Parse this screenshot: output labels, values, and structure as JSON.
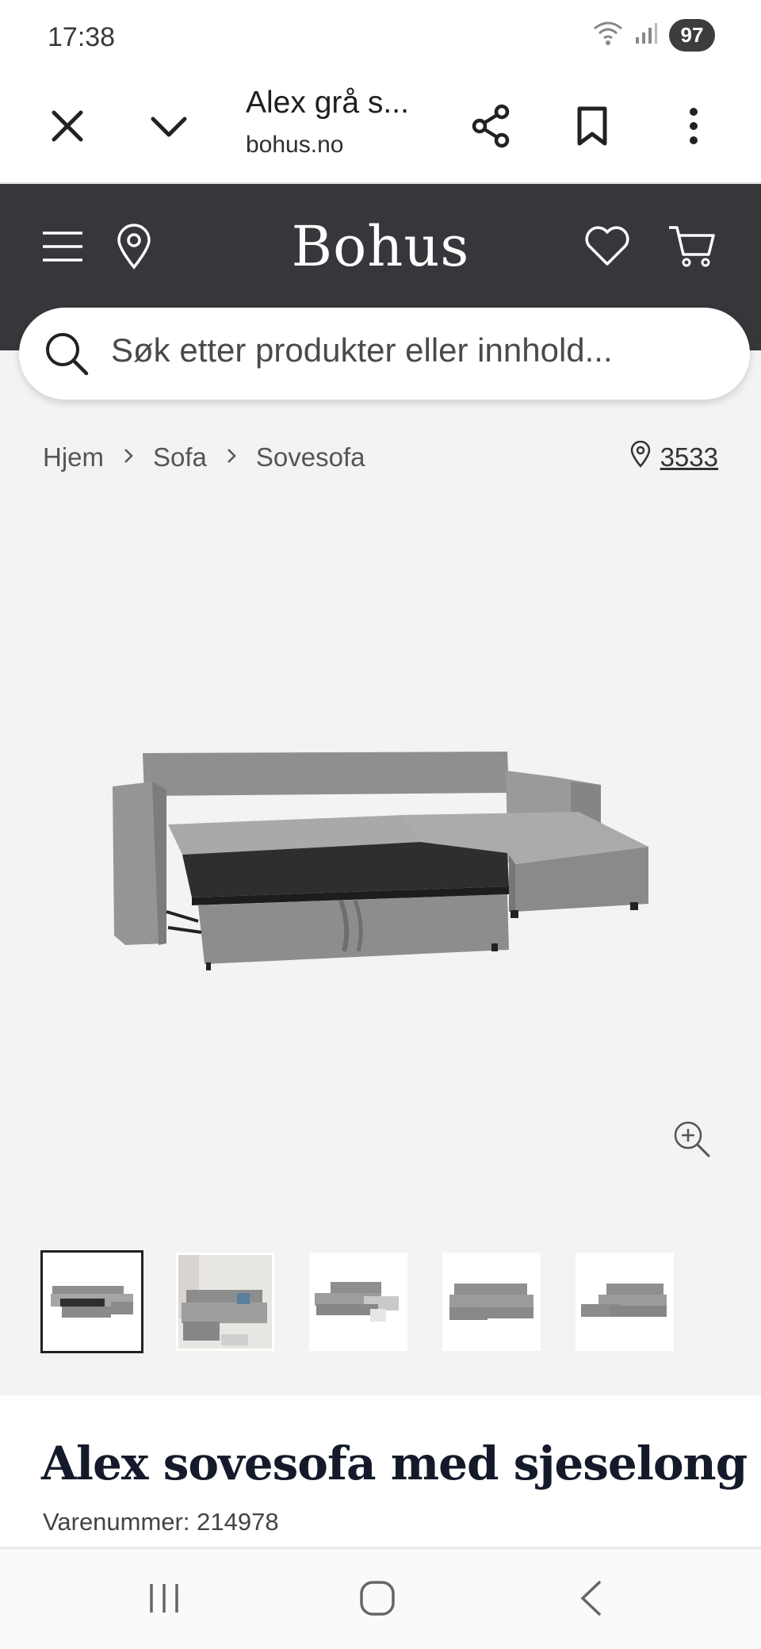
{
  "status_bar": {
    "time": "17:38",
    "battery": "97"
  },
  "browser": {
    "title": "Alex grå s...",
    "url": "bohus.no"
  },
  "site": {
    "logo": "Bohus"
  },
  "search": {
    "placeholder": "Søk etter produkter eller innhold..."
  },
  "breadcrumb": {
    "items": [
      "Hjem",
      "Sofa",
      "Sovesofa"
    ]
  },
  "store": {
    "number": "3533"
  },
  "gallery": {
    "thumbnail_count": 5,
    "selected_index": 0
  },
  "product": {
    "title": "Alex sovesofa med sjeselong",
    "sku_label": "Varenummer:",
    "sku": "214978"
  },
  "colors": {
    "header_bg": "#37363b",
    "page_bg": "#f4f3f1",
    "title_color": "#141a2a",
    "sofa_gray": "#8e8e8e"
  }
}
